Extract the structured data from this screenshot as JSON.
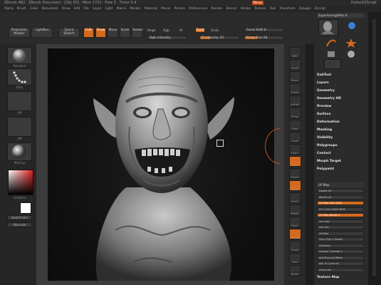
{
  "titlebar": {
    "left_text": "ZBrush 4R2 · ZBrush Document · [Obj 3D] · Mem 1722 · Free 3 · Timer 0.4",
    "badge": "Menus",
    "right_text": "DefaultZScript"
  },
  "menubar": {
    "items": [
      "Alpha",
      "Brush",
      "Color",
      "Document",
      "Draw",
      "Edit",
      "File",
      "Layer",
      "Light",
      "Macro",
      "Marker",
      "Material",
      "Movie",
      "Picture",
      "Preferences",
      "Render",
      "Stencil",
      "Stroke",
      "Texture",
      "Tool",
      "Transform",
      "Zplugin",
      "Zscript"
    ]
  },
  "toolbar": {
    "projection_master": "Projection Master",
    "lightbox": "LightBox",
    "quick_sketch": "Quick Sketch",
    "edit": "Edit",
    "draw": "Draw",
    "move": "Move",
    "scale": "Scale",
    "rotate": "Rotate",
    "mrgb": "Mrgb",
    "rgb": "Rgb",
    "m": "M",
    "zadd": "Zadd",
    "zsub": "Zsub",
    "rgb_intensity": "Rgb Intensity",
    "z_intensity": "Z Intensity 25",
    "focal_shift": "Focal Shift 0",
    "draw_size": "Draw Size 64",
    "z_intensity_value": 25,
    "draw_size_value": 64
  },
  "leftpanel": {
    "brush_label": "Standard",
    "stroke_label": "Dots",
    "alpha_label": "Off",
    "texture_label": "Off",
    "material_label": "MatCap",
    "gradient_label": "Gradient",
    "switch_color": "SwitchColor",
    "alternate": "Alternate",
    "swatch_color": "#d03030"
  },
  "rightshelf": {
    "buttons": [
      "BPR",
      "Scroll",
      "Zoom",
      "Actual",
      "AAHalf",
      "Persp",
      "Floor",
      "Local",
      "LSym",
      "Xyz",
      "Frame",
      "Move",
      "Scale",
      "Rotate",
      "PolyF",
      "Transp",
      "Ghost",
      "Solo",
      "Xpose"
    ],
    "active": [
      "Xyz",
      "Move",
      "Transp"
    ]
  },
  "palette": {
    "header": "SuperAverageMan 6",
    "thumbs": [
      "SuperAverageMan",
      "Cylinder3D",
      "SimpleBrush",
      "PolyMesh3D",
      "EraserBrush",
      "SphereBrush"
    ],
    "menus": [
      "SubTool",
      "Layers",
      "Geometry",
      "Geometry HD",
      "Preview",
      "Surface",
      "Deformation",
      "Masking",
      "Visibility",
      "Polygroups",
      "Contact",
      "Morph Target",
      "Polypaint"
    ],
    "uvmap_header": "UV Map",
    "uv_rows": [
      "Delete UV",
      "Morph UV",
      "UV Map Size 2048",
      "512  1024  2048  4096",
      "UV Map Border 4",
      "Uvc   Uvp",
      "Uvs   Uvt",
      "UVTiles",
      "Flip U  Flip V  Switch",
      "UVCheck",
      "Uvmap 1  Uvmap 2",
      "AUVTiles  AUVRatio",
      "Adj. Ts  Cycle UV",
      "Clear   Uvs"
    ],
    "texture_map": "Texture Map"
  },
  "canvas": {
    "subject": "sculpted goblin head"
  }
}
